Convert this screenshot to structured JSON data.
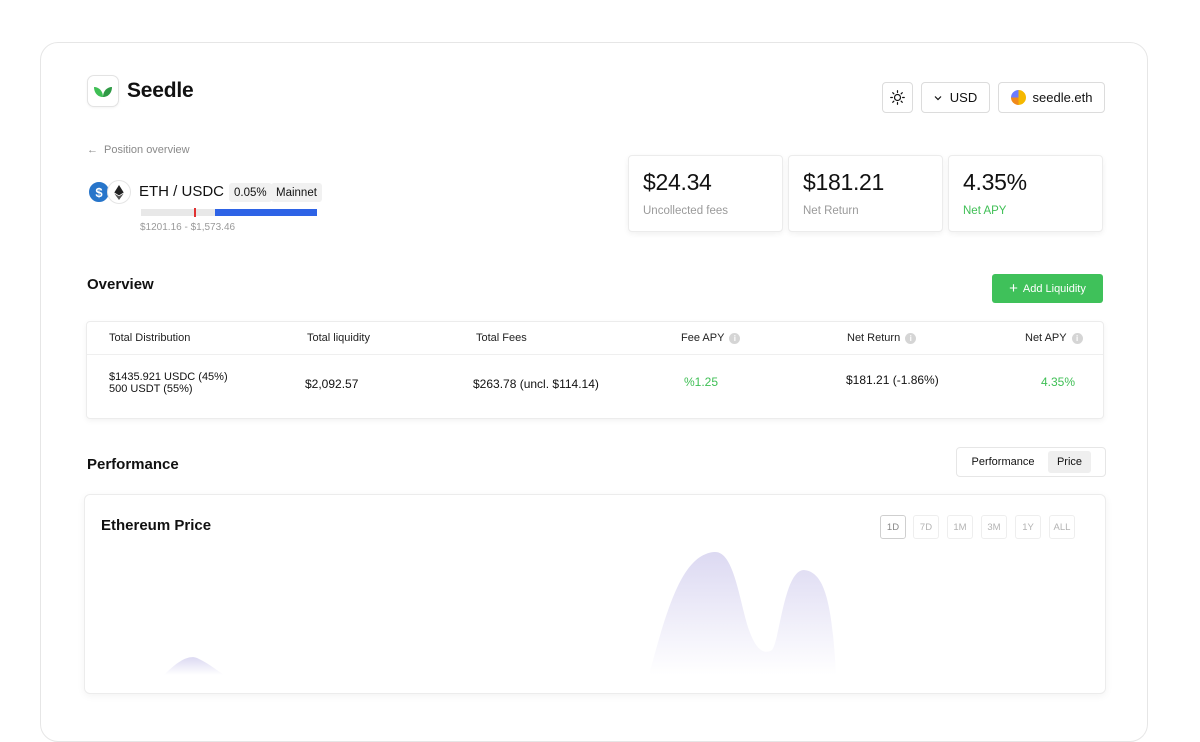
{
  "header": {
    "brand": "Seedle",
    "currency": "USD",
    "wallet": "seedle.eth",
    "icons": [
      "leaf-logo-icon",
      "sun-icon",
      "chevron-down-icon",
      "wallet-avatar-icon"
    ]
  },
  "position": {
    "back_label": "Position overview",
    "pair": "ETH / USDC",
    "fee_tier": "0.05%",
    "network": "Mainnet",
    "range_text": "$1201.16 - $1,573.46",
    "range_fill_start_pct": 42
  },
  "stats": [
    {
      "value": "$24.34",
      "label": "Uncollected fees"
    },
    {
      "value": "$181.21",
      "label": "Net Return"
    },
    {
      "value": "4.35%",
      "label": "Net APY"
    }
  ],
  "overview": {
    "title": "Overview",
    "add_button": "Add Liquidity",
    "columns": [
      "Total Distribution",
      "Total liquidity",
      "Total Fees",
      "Fee APY",
      "Net Return",
      "Net APY"
    ],
    "row": {
      "distribution_line1": "$1435.921 USDC (45%)",
      "distribution_line2": "500 USDT (55%)",
      "liquidity": "$2,092.57",
      "fees": "$263.78 (uncl. $114.14)",
      "fee_apy": "%1.25",
      "net_return": "$181.21 (-1.86%)",
      "net_apy": "4.35%"
    }
  },
  "performance": {
    "title": "Performance",
    "tabs": [
      "Performance",
      "Price"
    ],
    "active_tab": "Price",
    "chart_title": "Ethereum Price",
    "ranges": [
      "1D",
      "7D",
      "1M",
      "3M",
      "1Y",
      "ALL"
    ],
    "active_range": "1D"
  },
  "colors": {
    "accent_green": "#3fc15a",
    "range_blue": "#2e63e6",
    "chart_fill": "#e4e2f4"
  }
}
